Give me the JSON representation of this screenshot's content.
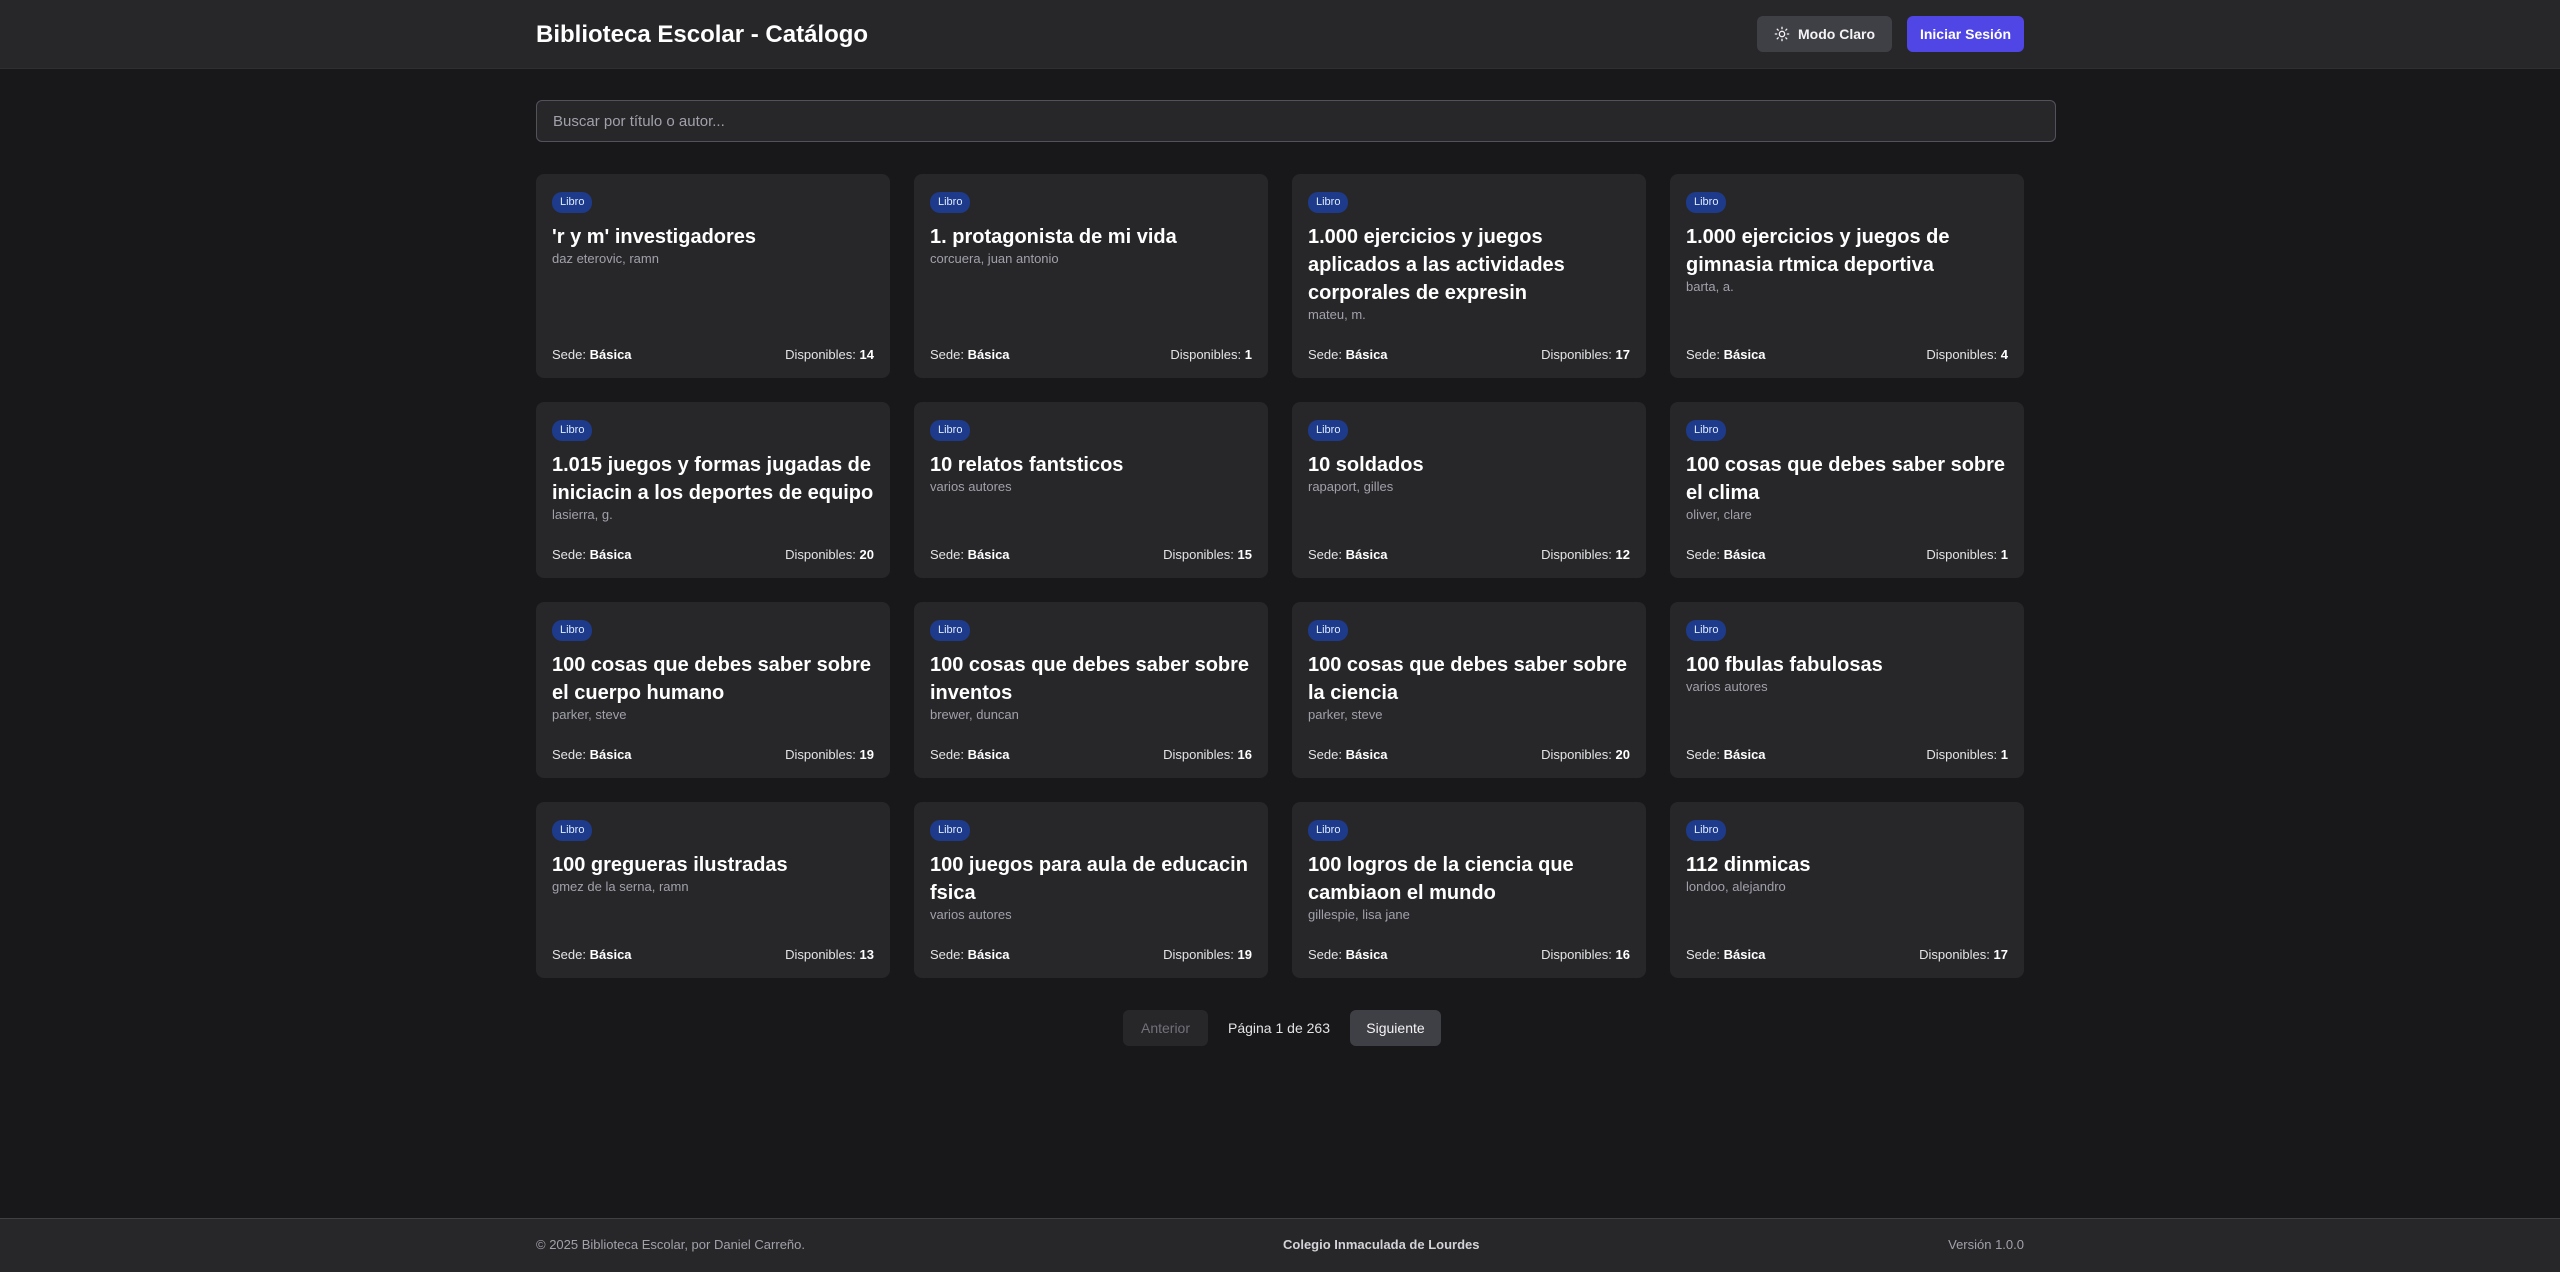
{
  "header": {
    "title": "Biblioteca Escolar - Catálogo",
    "theme_button": "Modo Claro",
    "login_button": "Iniciar Sesión"
  },
  "search": {
    "placeholder": "Buscar por título o autor..."
  },
  "labels": {
    "sede": "Sede:",
    "disponibles": "Disponibles:"
  },
  "books": [
    {
      "badge": "Libro",
      "title": "'r y m' investigadores",
      "author": "daz eterovic, ramn",
      "sede": "Básica",
      "disponibles": "14"
    },
    {
      "badge": "Libro",
      "title": "1. protagonista de mi vida",
      "author": "corcuera, juan antonio",
      "sede": "Básica",
      "disponibles": "1"
    },
    {
      "badge": "Libro",
      "title": "1.000 ejercicios y juegos aplicados a las actividades corporales de expresin",
      "author": "mateu, m.",
      "sede": "Básica",
      "disponibles": "17"
    },
    {
      "badge": "Libro",
      "title": "1.000 ejercicios y juegos de gimnasia rtmica deportiva",
      "author": "barta, a.",
      "sede": "Básica",
      "disponibles": "4"
    },
    {
      "badge": "Libro",
      "title": "1.015 juegos y formas jugadas de iniciacin a los deportes de equipo",
      "author": "lasierra, g.",
      "sede": "Básica",
      "disponibles": "20"
    },
    {
      "badge": "Libro",
      "title": "10 relatos fantsticos",
      "author": "varios autores",
      "sede": "Básica",
      "disponibles": "15"
    },
    {
      "badge": "Libro",
      "title": "10 soldados",
      "author": "rapaport, gilles",
      "sede": "Básica",
      "disponibles": "12"
    },
    {
      "badge": "Libro",
      "title": "100 cosas que debes saber sobre el clima",
      "author": "oliver, clare",
      "sede": "Básica",
      "disponibles": "1"
    },
    {
      "badge": "Libro",
      "title": "100 cosas que debes saber sobre el cuerpo humano",
      "author": "parker, steve",
      "sede": "Básica",
      "disponibles": "19"
    },
    {
      "badge": "Libro",
      "title": "100 cosas que debes saber sobre inventos",
      "author": "brewer, duncan",
      "sede": "Básica",
      "disponibles": "16"
    },
    {
      "badge": "Libro",
      "title": "100 cosas que debes saber sobre la ciencia",
      "author": "parker, steve",
      "sede": "Básica",
      "disponibles": "20"
    },
    {
      "badge": "Libro",
      "title": "100 fbulas fabulosas",
      "author": "varios autores",
      "sede": "Básica",
      "disponibles": "1"
    },
    {
      "badge": "Libro",
      "title": "100 gregueras ilustradas",
      "author": "gmez de la serna, ramn",
      "sede": "Básica",
      "disponibles": "13"
    },
    {
      "badge": "Libro",
      "title": "100 juegos para aula de educacin fsica",
      "author": "varios autores",
      "sede": "Básica",
      "disponibles": "19"
    },
    {
      "badge": "Libro",
      "title": "100 logros de la ciencia que cambiaon el mundo",
      "author": "gillespie, lisa jane",
      "sede": "Básica",
      "disponibles": "16"
    },
    {
      "badge": "Libro",
      "title": "112 dinmicas",
      "author": "londoo, alejandro",
      "sede": "Básica",
      "disponibles": "17"
    }
  ],
  "pagination": {
    "prev": "Anterior",
    "info": "Página 1 de 263",
    "next": "Siguiente"
  },
  "footer": {
    "copyright": "© 2025 Biblioteca Escolar, por Daniel Carreño.",
    "school": "Colegio Inmaculada de Lourdes",
    "version": "Versión 1.0.0"
  },
  "colors": {
    "background": "#18181b",
    "surface": "#27272a",
    "accent": "#4f46e5",
    "badge": "#1e3a8a"
  },
  "icons": {
    "theme": "sun-icon"
  }
}
